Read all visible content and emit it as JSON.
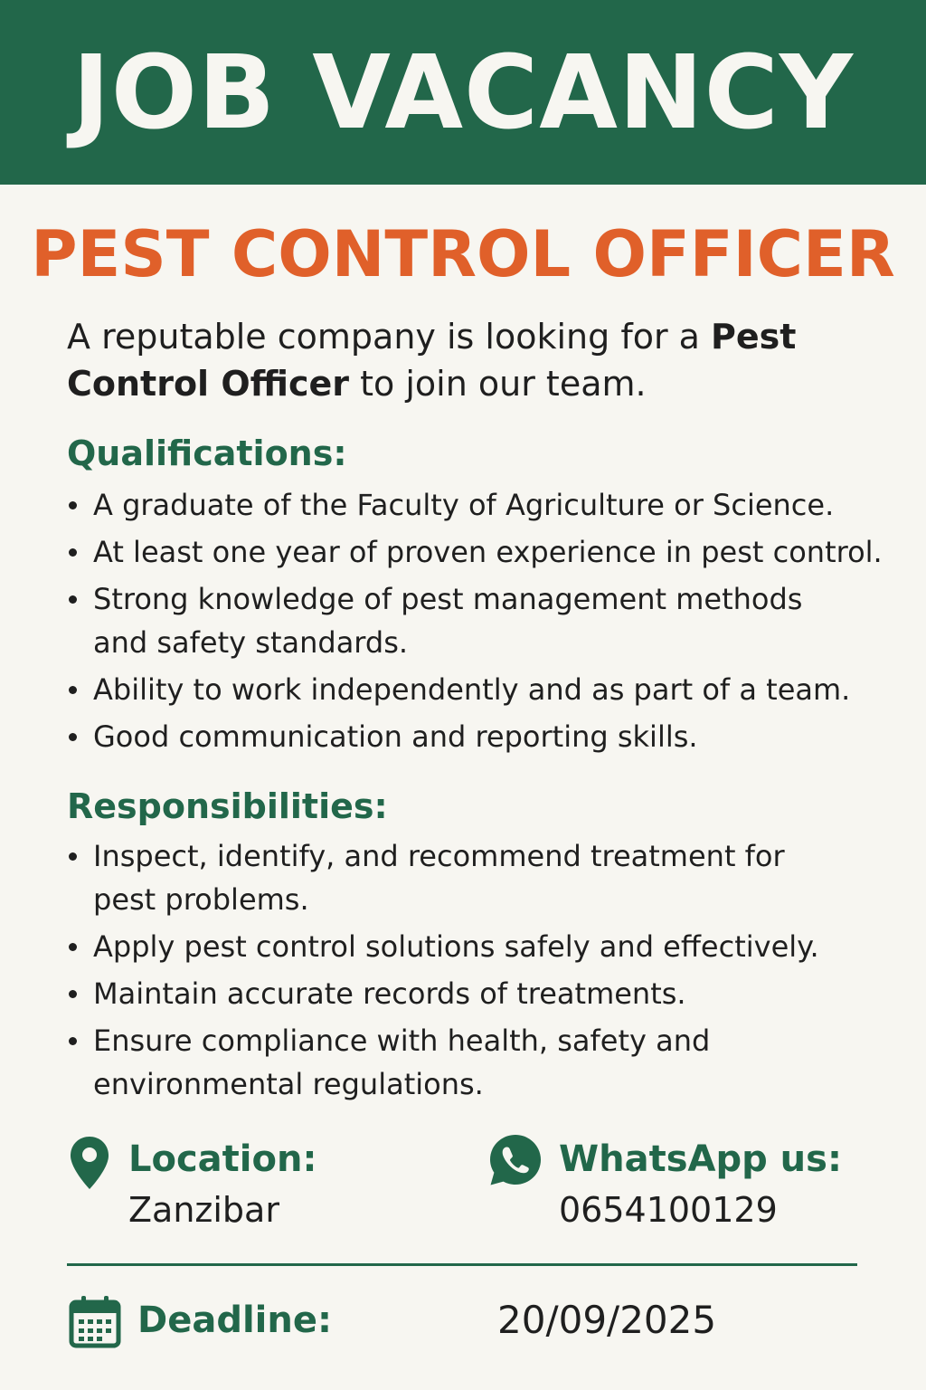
{
  "header": {
    "title": "JOB VACANCY"
  },
  "job_title": "PEST CONTROL OFFICER",
  "intro": {
    "prefix": "A reputable company is looking for a ",
    "highlight": "Pest Control Officer",
    "suffix": " to join our team."
  },
  "qualifications": {
    "heading": "Qualifications:",
    "items": [
      "A graduate of the Faculty of Agriculture or Science.",
      "At least one year of proven experience in pest control.",
      "Strong knowledge of pest management methods and safety standards.",
      "Ability to work independently and as part of a team.",
      "Good communication and reporting skills."
    ]
  },
  "responsibilities": {
    "heading": "Responsibilities:",
    "items": [
      "Inspect, identify, and recommend treatment for pest problems.",
      "Apply pest control solutions safely and effectively.",
      "Maintain accurate records of treatments.",
      "Ensure compliance with health, safety and environmental regulations."
    ]
  },
  "location": {
    "label": "Location:",
    "value": "Zanzibar",
    "icon": "location-pin-icon"
  },
  "whatsapp": {
    "label": "WhatsApp us:",
    "value": "0654100129",
    "icon": "whatsapp-icon"
  },
  "deadline": {
    "label": "Deadline:",
    "value": "20/09/2025",
    "icon": "calendar-icon"
  },
  "colors": {
    "brand_green": "#22674a",
    "accent_orange": "#e0602a",
    "background": "#f7f6f1",
    "text": "#1f1f1f"
  }
}
